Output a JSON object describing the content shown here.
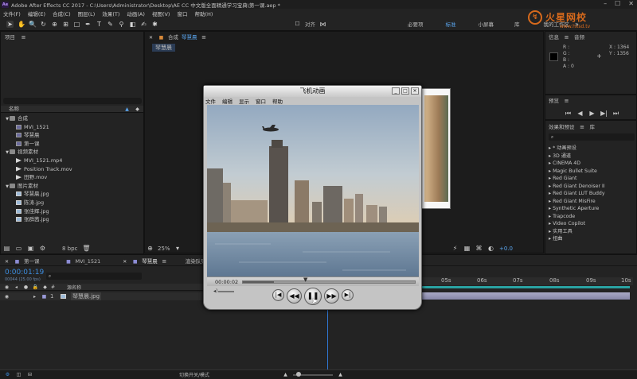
{
  "window": {
    "title": "Adobe After Effects CC 2017 - C:\\Users\\Administrator\\Desktop\\AE CC 中文版全面精通学习宝典\\第一课.aep *",
    "app_badge": "Ae"
  },
  "watermark": {
    "line1": "火星网校",
    "line2": "www.hxsd.tv"
  },
  "menu": [
    "文件(F)",
    "编辑(E)",
    "合成(C)",
    "图层(L)",
    "效果(T)",
    "动画(A)",
    "视图(V)",
    "窗口",
    "帮助(H)"
  ],
  "toolbar": {
    "snap_label": "对齐",
    "workspaces": [
      "必要项",
      "标准",
      "小屏幕",
      "库",
      "我的工作区"
    ],
    "active_workspace": "标准"
  },
  "project": {
    "tab": "项目",
    "col_name": "名称",
    "items": [
      {
        "name": "合成",
        "kind": "folder",
        "indent": 0
      },
      {
        "name": "MVI_1521",
        "kind": "comp",
        "indent": 1
      },
      {
        "name": "琴慧晨",
        "kind": "comp",
        "indent": 1
      },
      {
        "name": "第一课",
        "kind": "comp",
        "indent": 1
      },
      {
        "name": "视频素材",
        "kind": "folder",
        "indent": 0
      },
      {
        "name": "MVI_1521.mp4",
        "kind": "vid",
        "indent": 1
      },
      {
        "name": "Position Track.mov",
        "kind": "vid",
        "indent": 1
      },
      {
        "name": "田野.mov",
        "kind": "vid",
        "indent": 1
      },
      {
        "name": "图片素材",
        "kind": "folder",
        "indent": 0
      },
      {
        "name": "琴慧晨.jpg",
        "kind": "img",
        "indent": 1
      },
      {
        "name": "陈涛.jpg",
        "kind": "img",
        "indent": 1
      },
      {
        "name": "张佳辉.jpg",
        "kind": "img",
        "indent": 1
      },
      {
        "name": "张群茜.jpg",
        "kind": "img",
        "indent": 1
      }
    ],
    "bpc": "8 bpc"
  },
  "composition": {
    "tab_prefix": "合成",
    "tab_name": "琴慧晨",
    "breadcrumb": "琴慧晨",
    "zoom": "25%",
    "exposure": "+0.0"
  },
  "info": {
    "tab_info": "信息",
    "tab_audio": "音频",
    "r": "R :",
    "g": "G :",
    "b": "B :",
    "a": "A : 0",
    "x": "X : 1364",
    "y": "Y : 1356"
  },
  "preview": {
    "tab": "预览"
  },
  "effects": {
    "tab": "效果和预设",
    "tab_lib": "库",
    "items": [
      "* 动画预设",
      "3D 通道",
      "CINEMA 4D",
      "Magic Bullet Suite",
      "Red Giant",
      "Red Giant Denoiser II",
      "Red Giant LUT Buddy",
      "Red Giant MisFire",
      "Synthetic Aperture",
      "Trapcode",
      "Video Copilot",
      "实用工具",
      "扭曲"
    ]
  },
  "player": {
    "title": "飞机动画",
    "menu": [
      "文件",
      "编辑",
      "显示",
      "窗口",
      "帮助"
    ],
    "time": "00:00:02",
    "progress": 0.18
  },
  "timeline": {
    "tabs": [
      "第一课",
      "MVI_1521",
      "琴慧晨",
      "渲染队列"
    ],
    "active_tab": "琴慧晨",
    "timecode": "0:00:01:19",
    "frames": "00044 (25.00 fps)",
    "col_source": "源名称",
    "layer_num": "1",
    "layer_name": "琴慧晨.jpg",
    "ruler": [
      "05s",
      "06s",
      "07s",
      "08s",
      "09s",
      "10s"
    ],
    "toggle_label": "切换开关/模式"
  }
}
